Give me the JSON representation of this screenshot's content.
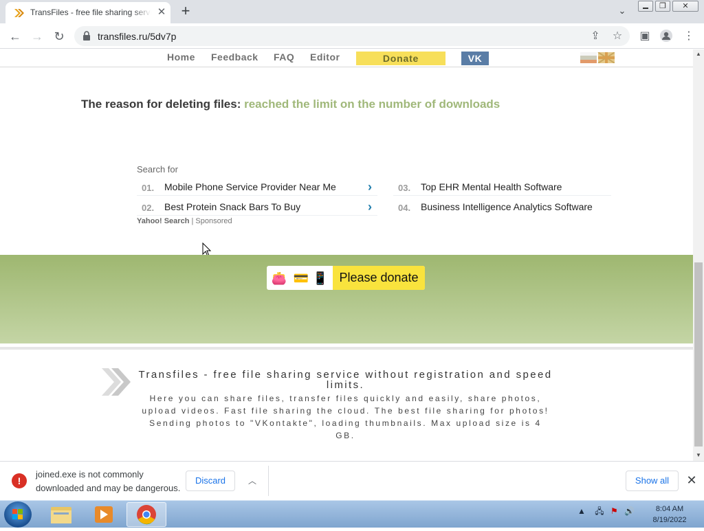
{
  "browser": {
    "tab_title": "TransFiles - free file sharing service",
    "tab_close": "✕",
    "new_tab": "+",
    "tab_list": "⌄",
    "url": "transfiles.ru/5dv7p",
    "minimize": "▭",
    "restore": "❐",
    "close": "✕"
  },
  "site_nav": {
    "items": [
      "Home",
      "Feedback",
      "FAQ",
      "Editor"
    ],
    "donate": "Donate",
    "vk": "VK"
  },
  "reason": {
    "label": "The reason for deleting files:",
    "value": "reached the limit on the number of downloads"
  },
  "ads": {
    "search_for": "Search for",
    "items": [
      {
        "num": "01.",
        "text": "Mobile Phone Service Provider Near Me"
      },
      {
        "num": "02.",
        "text": "Best Protein Snack Bars To Buy"
      },
      {
        "num": "03.",
        "text": "Top EHR Mental Health Software"
      },
      {
        "num": "04.",
        "text": "Business Intelligence Analytics Software"
      }
    ],
    "provider": "Yahoo! Search",
    "sponsored": "| Sponsored"
  },
  "donate_widget": {
    "label": "Please donate"
  },
  "footer": {
    "title": "Transfiles - free file sharing service without registration and speed limits.",
    "text": "Here you can share files, transfer files quickly and easily, share photos, upload videos. Fast file sharing the cloud. The best file sharing for photos! Sending photos to \"VKontakte\", loading thumbnails. Max upload size is 4 GB."
  },
  "download_bar": {
    "message": "joined.exe is not commonly downloaded and may be dangerous.",
    "discard": "Discard",
    "show_all": "Show all"
  },
  "taskbar": {
    "time": "8:04 AM",
    "date": "8/19/2022"
  },
  "colors": {
    "accent_green": "#a0b87a",
    "donate_yellow": "#f9e33d",
    "vk_blue": "#5a7da6"
  }
}
